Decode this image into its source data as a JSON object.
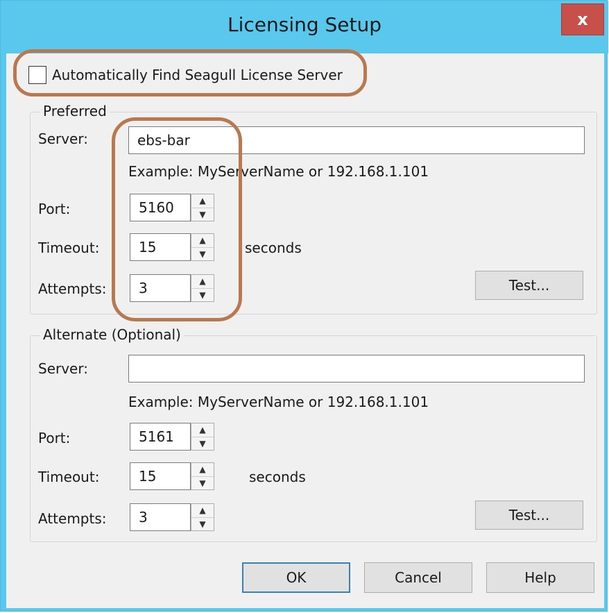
{
  "window": {
    "title": "Licensing Setup",
    "close_glyph": "x"
  },
  "auto_find": {
    "label": "Automatically Find Seagull License Server",
    "checked": false
  },
  "preferred": {
    "group_title": "Preferred",
    "server_label": "Server:",
    "server_value": "ebs-bar",
    "example": "Example: MyServerName or 192.168.1.101",
    "port_label": "Port:",
    "port_value": "5160",
    "timeout_label": "Timeout:",
    "timeout_value": "15",
    "timeout_unit": "seconds",
    "attempts_label": "Attempts:",
    "attempts_value": "3",
    "test_label": "Test..."
  },
  "alternate": {
    "group_title": "Alternate (Optional)",
    "server_label": "Server:",
    "server_value": "",
    "example": "Example: MyServerName or 192.168.1.101",
    "port_label": "Port:",
    "port_value": "5161",
    "timeout_label": "Timeout:",
    "timeout_value": "15",
    "timeout_unit": "seconds",
    "attempts_label": "Attempts:",
    "attempts_value": "3",
    "test_label": "Test..."
  },
  "footer": {
    "ok_label": "OK",
    "cancel_label": "Cancel",
    "help_label": "Help"
  },
  "icons": {
    "spin_up": "▲",
    "spin_down": "▼"
  },
  "colors": {
    "titlebar": "#5ac8ec",
    "close": "#c7504a",
    "annotation": "#b87850"
  }
}
